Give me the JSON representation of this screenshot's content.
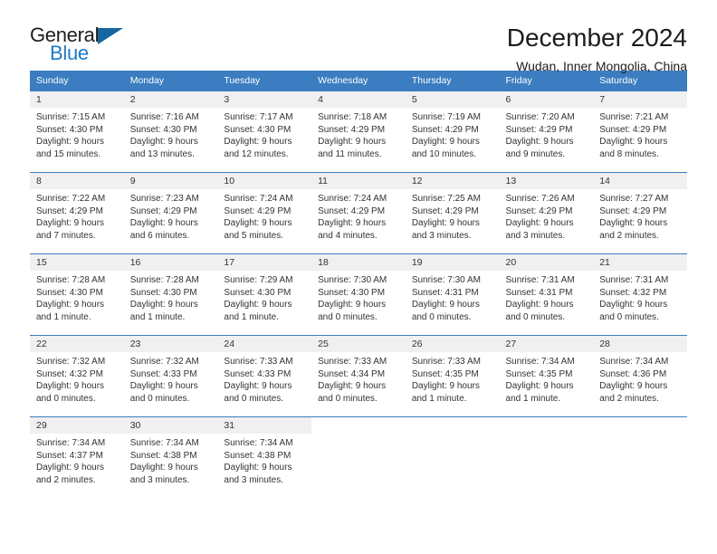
{
  "brand": {
    "name_part1": "General",
    "name_part2": "Blue",
    "triangle_color": "#15669e",
    "blue_text_color": "#1f7ac4"
  },
  "header": {
    "title": "December 2024",
    "subtitle": "Wudan, Inner Mongolia, China"
  },
  "theme": {
    "header_row_bg": "#3b7dc0",
    "daynum_bg": "#f0f0f0",
    "text_color": "#333333"
  },
  "weekdays": [
    "Sunday",
    "Monday",
    "Tuesday",
    "Wednesday",
    "Thursday",
    "Friday",
    "Saturday"
  ],
  "weeks": [
    [
      {
        "day": "1",
        "sunrise": "Sunrise: 7:15 AM",
        "sunset": "Sunset: 4:30 PM",
        "daylight1": "Daylight: 9 hours",
        "daylight2": "and 15 minutes."
      },
      {
        "day": "2",
        "sunrise": "Sunrise: 7:16 AM",
        "sunset": "Sunset: 4:30 PM",
        "daylight1": "Daylight: 9 hours",
        "daylight2": "and 13 minutes."
      },
      {
        "day": "3",
        "sunrise": "Sunrise: 7:17 AM",
        "sunset": "Sunset: 4:30 PM",
        "daylight1": "Daylight: 9 hours",
        "daylight2": "and 12 minutes."
      },
      {
        "day": "4",
        "sunrise": "Sunrise: 7:18 AM",
        "sunset": "Sunset: 4:29 PM",
        "daylight1": "Daylight: 9 hours",
        "daylight2": "and 11 minutes."
      },
      {
        "day": "5",
        "sunrise": "Sunrise: 7:19 AM",
        "sunset": "Sunset: 4:29 PM",
        "daylight1": "Daylight: 9 hours",
        "daylight2": "and 10 minutes."
      },
      {
        "day": "6",
        "sunrise": "Sunrise: 7:20 AM",
        "sunset": "Sunset: 4:29 PM",
        "daylight1": "Daylight: 9 hours",
        "daylight2": "and 9 minutes."
      },
      {
        "day": "7",
        "sunrise": "Sunrise: 7:21 AM",
        "sunset": "Sunset: 4:29 PM",
        "daylight1": "Daylight: 9 hours",
        "daylight2": "and 8 minutes."
      }
    ],
    [
      {
        "day": "8",
        "sunrise": "Sunrise: 7:22 AM",
        "sunset": "Sunset: 4:29 PM",
        "daylight1": "Daylight: 9 hours",
        "daylight2": "and 7 minutes."
      },
      {
        "day": "9",
        "sunrise": "Sunrise: 7:23 AM",
        "sunset": "Sunset: 4:29 PM",
        "daylight1": "Daylight: 9 hours",
        "daylight2": "and 6 minutes."
      },
      {
        "day": "10",
        "sunrise": "Sunrise: 7:24 AM",
        "sunset": "Sunset: 4:29 PM",
        "daylight1": "Daylight: 9 hours",
        "daylight2": "and 5 minutes."
      },
      {
        "day": "11",
        "sunrise": "Sunrise: 7:24 AM",
        "sunset": "Sunset: 4:29 PM",
        "daylight1": "Daylight: 9 hours",
        "daylight2": "and 4 minutes."
      },
      {
        "day": "12",
        "sunrise": "Sunrise: 7:25 AM",
        "sunset": "Sunset: 4:29 PM",
        "daylight1": "Daylight: 9 hours",
        "daylight2": "and 3 minutes."
      },
      {
        "day": "13",
        "sunrise": "Sunrise: 7:26 AM",
        "sunset": "Sunset: 4:29 PM",
        "daylight1": "Daylight: 9 hours",
        "daylight2": "and 3 minutes."
      },
      {
        "day": "14",
        "sunrise": "Sunrise: 7:27 AM",
        "sunset": "Sunset: 4:29 PM",
        "daylight1": "Daylight: 9 hours",
        "daylight2": "and 2 minutes."
      }
    ],
    [
      {
        "day": "15",
        "sunrise": "Sunrise: 7:28 AM",
        "sunset": "Sunset: 4:30 PM",
        "daylight1": "Daylight: 9 hours",
        "daylight2": "and 1 minute."
      },
      {
        "day": "16",
        "sunrise": "Sunrise: 7:28 AM",
        "sunset": "Sunset: 4:30 PM",
        "daylight1": "Daylight: 9 hours",
        "daylight2": "and 1 minute."
      },
      {
        "day": "17",
        "sunrise": "Sunrise: 7:29 AM",
        "sunset": "Sunset: 4:30 PM",
        "daylight1": "Daylight: 9 hours",
        "daylight2": "and 1 minute."
      },
      {
        "day": "18",
        "sunrise": "Sunrise: 7:30 AM",
        "sunset": "Sunset: 4:30 PM",
        "daylight1": "Daylight: 9 hours",
        "daylight2": "and 0 minutes."
      },
      {
        "day": "19",
        "sunrise": "Sunrise: 7:30 AM",
        "sunset": "Sunset: 4:31 PM",
        "daylight1": "Daylight: 9 hours",
        "daylight2": "and 0 minutes."
      },
      {
        "day": "20",
        "sunrise": "Sunrise: 7:31 AM",
        "sunset": "Sunset: 4:31 PM",
        "daylight1": "Daylight: 9 hours",
        "daylight2": "and 0 minutes."
      },
      {
        "day": "21",
        "sunrise": "Sunrise: 7:31 AM",
        "sunset": "Sunset: 4:32 PM",
        "daylight1": "Daylight: 9 hours",
        "daylight2": "and 0 minutes."
      }
    ],
    [
      {
        "day": "22",
        "sunrise": "Sunrise: 7:32 AM",
        "sunset": "Sunset: 4:32 PM",
        "daylight1": "Daylight: 9 hours",
        "daylight2": "and 0 minutes."
      },
      {
        "day": "23",
        "sunrise": "Sunrise: 7:32 AM",
        "sunset": "Sunset: 4:33 PM",
        "daylight1": "Daylight: 9 hours",
        "daylight2": "and 0 minutes."
      },
      {
        "day": "24",
        "sunrise": "Sunrise: 7:33 AM",
        "sunset": "Sunset: 4:33 PM",
        "daylight1": "Daylight: 9 hours",
        "daylight2": "and 0 minutes."
      },
      {
        "day": "25",
        "sunrise": "Sunrise: 7:33 AM",
        "sunset": "Sunset: 4:34 PM",
        "daylight1": "Daylight: 9 hours",
        "daylight2": "and 0 minutes."
      },
      {
        "day": "26",
        "sunrise": "Sunrise: 7:33 AM",
        "sunset": "Sunset: 4:35 PM",
        "daylight1": "Daylight: 9 hours",
        "daylight2": "and 1 minute."
      },
      {
        "day": "27",
        "sunrise": "Sunrise: 7:34 AM",
        "sunset": "Sunset: 4:35 PM",
        "daylight1": "Daylight: 9 hours",
        "daylight2": "and 1 minute."
      },
      {
        "day": "28",
        "sunrise": "Sunrise: 7:34 AM",
        "sunset": "Sunset: 4:36 PM",
        "daylight1": "Daylight: 9 hours",
        "daylight2": "and 2 minutes."
      }
    ],
    [
      {
        "day": "29",
        "sunrise": "Sunrise: 7:34 AM",
        "sunset": "Sunset: 4:37 PM",
        "daylight1": "Daylight: 9 hours",
        "daylight2": "and 2 minutes."
      },
      {
        "day": "30",
        "sunrise": "Sunrise: 7:34 AM",
        "sunset": "Sunset: 4:38 PM",
        "daylight1": "Daylight: 9 hours",
        "daylight2": "and 3 minutes."
      },
      {
        "day": "31",
        "sunrise": "Sunrise: 7:34 AM",
        "sunset": "Sunset: 4:38 PM",
        "daylight1": "Daylight: 9 hours",
        "daylight2": "and 3 minutes."
      },
      {
        "day": "",
        "sunrise": "",
        "sunset": "",
        "daylight1": "",
        "daylight2": ""
      },
      {
        "day": "",
        "sunrise": "",
        "sunset": "",
        "daylight1": "",
        "daylight2": ""
      },
      {
        "day": "",
        "sunrise": "",
        "sunset": "",
        "daylight1": "",
        "daylight2": ""
      },
      {
        "day": "",
        "sunrise": "",
        "sunset": "",
        "daylight1": "",
        "daylight2": ""
      }
    ]
  ]
}
